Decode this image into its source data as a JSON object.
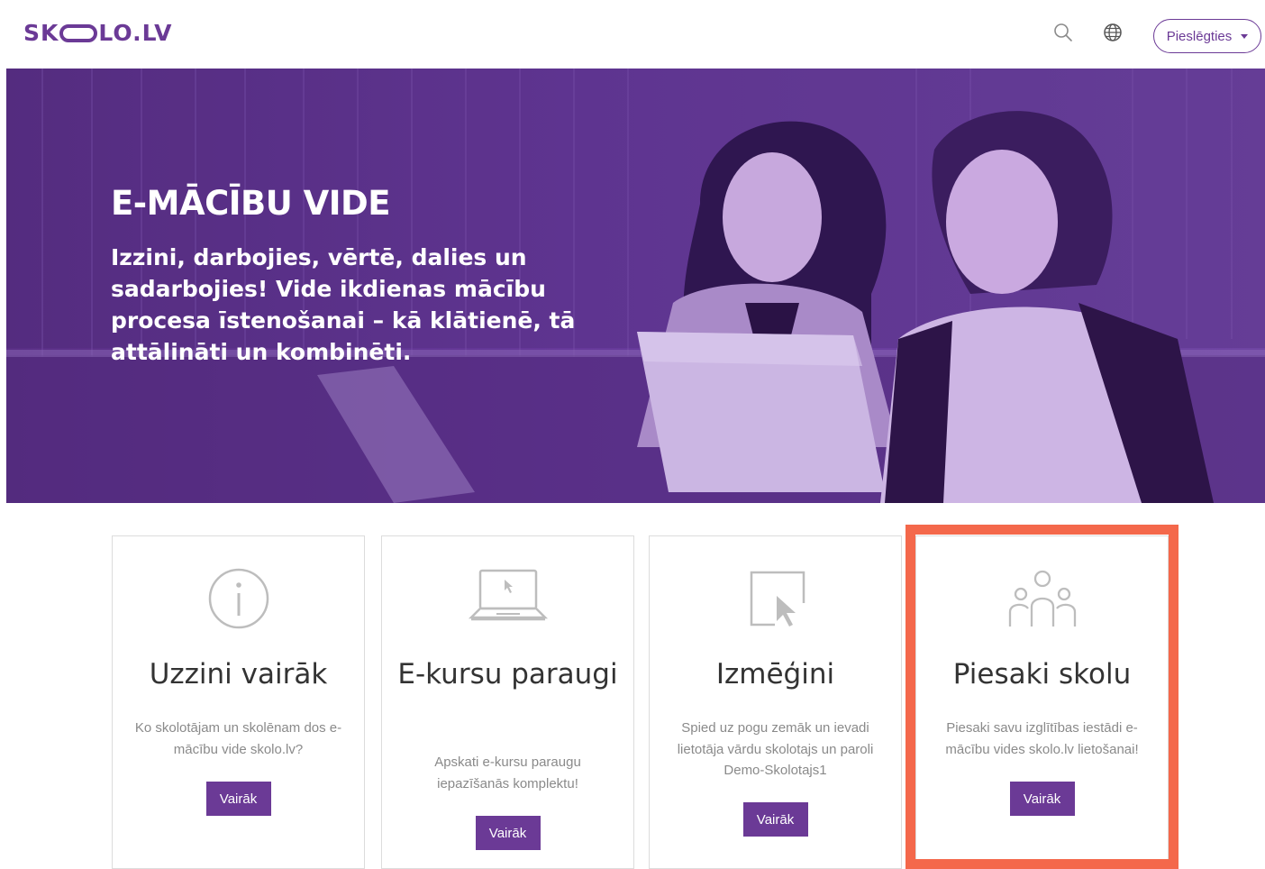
{
  "header": {
    "logo_left": "SK",
    "logo_right": "LO.LV",
    "search_icon": "search-icon",
    "language_icon": "globe-icon",
    "login_label": "Pieslēgties"
  },
  "hero": {
    "title": "E-MĀCĪBU VIDE",
    "subtitle": "Izzini, darbojies, vērtē, dalies un sadarbojies! Vide ikdienas mācību procesa īstenošanai – kā klātienē, tā attālināti un kombinēti.",
    "background_color": "#62358f"
  },
  "cards": [
    {
      "icon": "info-icon",
      "title": "Uzzini vairāk",
      "text": "Ko skolotājam un skolēnam dos e-mācību vide skolo.lv?",
      "button": "Vairāk"
    },
    {
      "icon": "laptop-icon",
      "title": "E-kursu paraugi",
      "text": "Apskati e-kursu paraugu iepazīšanās komplektu!",
      "button": "Vairāk"
    },
    {
      "icon": "cursor-icon",
      "title": "Izmēģini",
      "text": "Spied uz pogu zemāk un ievadi lietotāja vārdu skolotajs un paroli Demo-Skolotajs1",
      "button": "Vairāk"
    },
    {
      "icon": "people-icon",
      "title": "Piesaki skolu",
      "text": "Piesaki savu izglītības iestādi e-mācību vides skolo.lv lietošanai!",
      "button": "Vairāk"
    }
  ],
  "colors": {
    "brand": "#6b3a96",
    "highlight": "#f4684b",
    "muted_text": "#8a8a8a",
    "icon_gray": "#bdbdbd"
  }
}
